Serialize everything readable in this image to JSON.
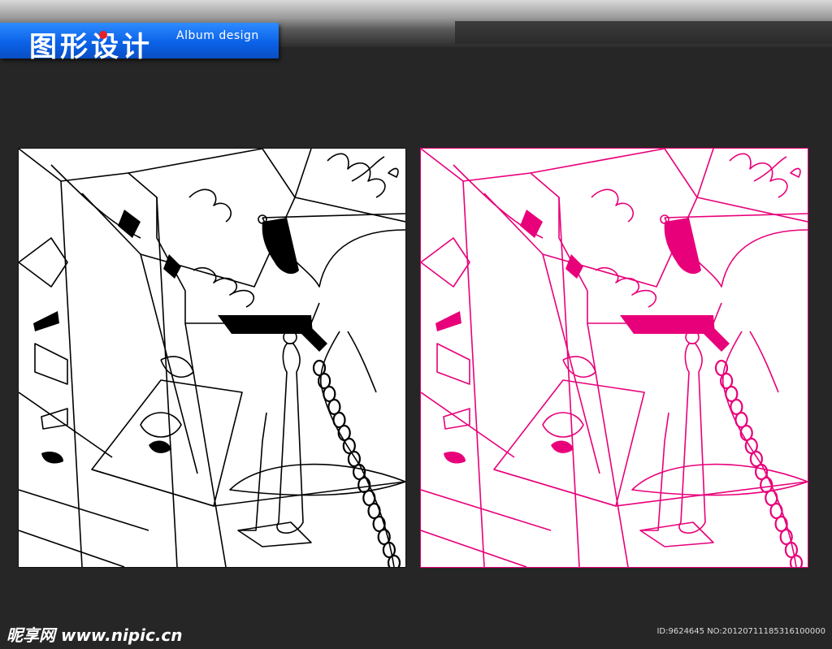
{
  "header": {
    "title_zh": "图形设计",
    "title_en": "Album design",
    "accent_color": "#0b62e8"
  },
  "panels": [
    {
      "name": "black-line-version",
      "line_color": "#000000"
    },
    {
      "name": "pink-line-version",
      "line_color": "#e8007a"
    }
  ],
  "footer": {
    "logo_text": "昵享网 www.nipic.cn",
    "id_text": "ID:9624645 NO:20120711185316100000"
  }
}
